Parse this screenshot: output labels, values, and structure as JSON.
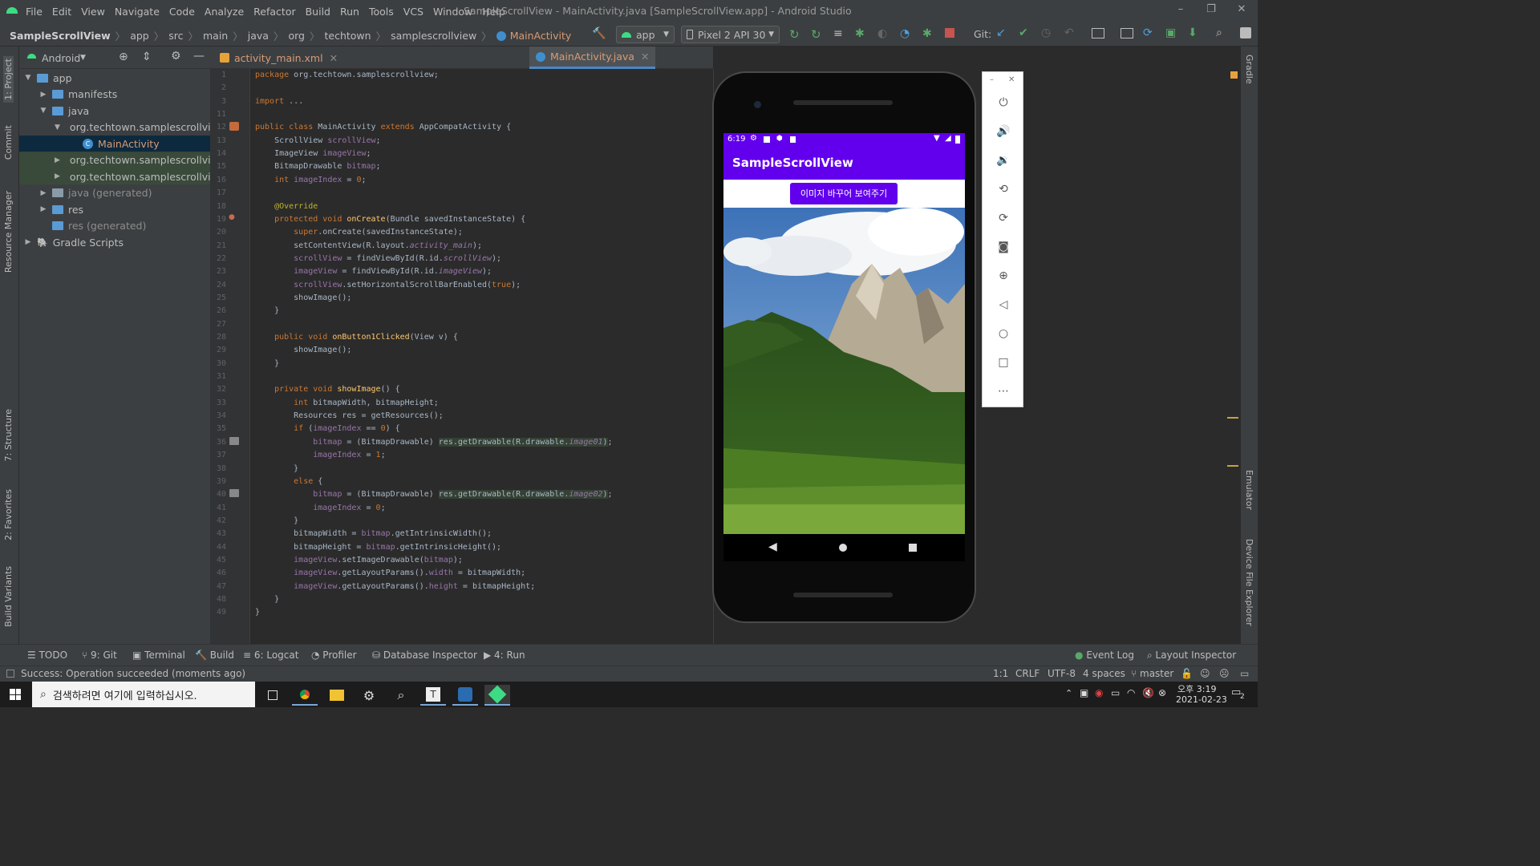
{
  "titlebar": {
    "menu": [
      "File",
      "Edit",
      "View",
      "Navigate",
      "Code",
      "Analyze",
      "Refactor",
      "Build",
      "Run",
      "Tools",
      "VCS",
      "Window",
      "Help"
    ],
    "title": "SampleScrollView - MainActivity.java [SampleScrollView.app] - Android Studio"
  },
  "navbar": {
    "breadcrumb": [
      "SampleScrollView",
      "app",
      "src",
      "main",
      "java",
      "org",
      "techtown",
      "samplescrollview",
      "MainActivity"
    ],
    "run_config": "app",
    "device": "Pixel 2 API 30",
    "git_label": "Git:"
  },
  "left_tool_tabs": [
    "1: Project",
    "Commit",
    "Resource Manager",
    "7: Structure",
    "2: Favorites",
    "Build Variants"
  ],
  "right_tool_tabs": [
    "Gradle",
    "Emulator",
    "Device File Explorer"
  ],
  "project_panel": {
    "view_mode": "Android",
    "tree": [
      {
        "label": "app",
        "indent": 0,
        "arrow": "▼",
        "icon": "folder"
      },
      {
        "label": "manifests",
        "indent": 1,
        "arrow": "▶",
        "icon": "folder"
      },
      {
        "label": "java",
        "indent": 1,
        "arrow": "▼",
        "icon": "folder"
      },
      {
        "label": "org.techtown.samplescrollview",
        "indent": 2,
        "arrow": "▼",
        "icon": "package"
      },
      {
        "label": "MainActivity",
        "indent": 3,
        "arrow": "",
        "icon": "class",
        "selected": true
      },
      {
        "label": "org.techtown.samplescrollview",
        "indent": 2,
        "arrow": "▶",
        "icon": "package",
        "highlight": true
      },
      {
        "label": "org.techtown.samplescrollview",
        "indent": 2,
        "arrow": "▶",
        "icon": "package",
        "highlight": true
      },
      {
        "label": "java (generated)",
        "indent": 1,
        "arrow": "▶",
        "icon": "folder-grey"
      },
      {
        "label": "res",
        "indent": 1,
        "arrow": "▶",
        "icon": "folder"
      },
      {
        "label": "res (generated)",
        "indent": 1,
        "arrow": "",
        "icon": "folder"
      },
      {
        "label": "Gradle Scripts",
        "indent": 0,
        "arrow": "▶",
        "icon": "gradle"
      }
    ]
  },
  "editor": {
    "tabs": [
      {
        "label": "activity_main.xml",
        "active": false
      },
      {
        "label": "MainActivity.java",
        "active": true
      }
    ],
    "line_numbers": [
      "1",
      "2",
      "3",
      "11",
      "12",
      "13",
      "14",
      "15",
      "16",
      "17",
      "18",
      "19",
      "20",
      "21",
      "22",
      "23",
      "24",
      "25",
      "26",
      "27",
      "28",
      "29",
      "30",
      "31",
      "32",
      "33",
      "34",
      "35",
      "36",
      "37",
      "38",
      "39",
      "40",
      "41",
      "42",
      "43",
      "44",
      "45",
      "46",
      "47",
      "48",
      "49"
    ],
    "lines": [
      [
        [
          "kw",
          "package "
        ],
        [
          "",
          "org.techtown.samplescrollview;"
        ]
      ],
      [],
      [
        [
          "kw",
          "import "
        ],
        [
          "",
          "..."
        ]
      ],
      [],
      [
        [
          "kw",
          "public class "
        ],
        [
          "",
          "MainActivity "
        ],
        [
          "kw",
          "extends "
        ],
        [
          "",
          "AppCompatActivity {"
        ]
      ],
      [
        [
          "",
          "    ScrollView "
        ],
        [
          "fld",
          "scrollView"
        ],
        [
          "",
          ";"
        ]
      ],
      [
        [
          "",
          "    ImageView "
        ],
        [
          "fld",
          "imageView"
        ],
        [
          "",
          ";"
        ]
      ],
      [
        [
          "",
          "    BitmapDrawable "
        ],
        [
          "fld",
          "bitmap"
        ],
        [
          "",
          ";"
        ]
      ],
      [
        [
          "kw",
          "    int "
        ],
        [
          "fld",
          "imageIndex "
        ],
        [
          "",
          "= "
        ],
        [
          "kw",
          "0"
        ],
        [
          "",
          ";"
        ]
      ],
      [],
      [
        [
          "ann",
          "    @Override"
        ]
      ],
      [
        [
          "kw",
          "    protected void "
        ],
        [
          "fn",
          "onCreate"
        ],
        [
          "",
          "(Bundle savedInstanceState) {"
        ]
      ],
      [
        [
          "kw",
          "        super"
        ],
        [
          "",
          ".onCreate(savedInstanceState);"
        ]
      ],
      [
        [
          "",
          "        setContentView(R.layout."
        ],
        [
          "fld it",
          "activity_main"
        ],
        [
          "",
          ");"
        ]
      ],
      [
        [
          "fld",
          "        scrollView "
        ],
        [
          "",
          "= findViewById(R.id."
        ],
        [
          "fld it",
          "scrollView"
        ],
        [
          "",
          ");"
        ]
      ],
      [
        [
          "fld",
          "        imageView "
        ],
        [
          "",
          "= findViewById(R.id."
        ],
        [
          "fld it",
          "imageView"
        ],
        [
          "",
          ");"
        ]
      ],
      [
        [
          "fld",
          "        scrollView"
        ],
        [
          "",
          ".setHorizontalScrollBarEnabled("
        ],
        [
          "kw",
          "true"
        ],
        [
          "",
          ");"
        ]
      ],
      [
        [
          "",
          "        showImage();"
        ]
      ],
      [
        [
          "",
          "    }"
        ]
      ],
      [],
      [
        [
          "kw",
          "    public void "
        ],
        [
          "fn",
          "onButton1Clicked"
        ],
        [
          "",
          "(View v) {"
        ]
      ],
      [
        [
          "",
          "        showImage();"
        ]
      ],
      [
        [
          "",
          "    }"
        ]
      ],
      [],
      [
        [
          "kw",
          "    private void "
        ],
        [
          "fn",
          "showImage"
        ],
        [
          "",
          "() {"
        ]
      ],
      [
        [
          "kw",
          "        int "
        ],
        [
          "",
          "bitmapWidth, bitmapHeight;"
        ]
      ],
      [
        [
          "",
          "        Resources res = getResources();"
        ]
      ],
      [
        [
          "kw",
          "        if "
        ],
        [
          "",
          "("
        ],
        [
          "fld",
          "imageIndex "
        ],
        [
          "",
          "== "
        ],
        [
          "kw",
          "0"
        ],
        [
          "",
          ") {"
        ]
      ],
      [
        [
          "fld",
          "            bitmap "
        ],
        [
          "",
          "= (BitmapDrawable) "
        ],
        [
          "hi",
          "res.getDrawable(R.drawable."
        ],
        [
          "hi fld it",
          "image01"
        ],
        [
          "hi",
          ")"
        ],
        [
          "",
          ";"
        ]
      ],
      [
        [
          "fld",
          "            imageIndex "
        ],
        [
          "",
          "= "
        ],
        [
          "kw",
          "1"
        ],
        [
          "",
          ";"
        ]
      ],
      [
        [
          "",
          "        }"
        ]
      ],
      [
        [
          "kw",
          "        else "
        ],
        [
          "",
          "{"
        ]
      ],
      [
        [
          "fld",
          "            bitmap "
        ],
        [
          "",
          "= (BitmapDrawable) "
        ],
        [
          "hi",
          "res.getDrawable(R.drawable."
        ],
        [
          "hi fld it",
          "image02"
        ],
        [
          "hi",
          ")"
        ],
        [
          "",
          ";"
        ]
      ],
      [
        [
          "fld",
          "            imageIndex "
        ],
        [
          "",
          "= "
        ],
        [
          "kw",
          "0"
        ],
        [
          "",
          ";"
        ]
      ],
      [
        [
          "",
          "        }"
        ]
      ],
      [
        [
          "",
          "        bitmapWidth = "
        ],
        [
          "fld",
          "bitmap"
        ],
        [
          "",
          ".getIntrinsicWidth();"
        ]
      ],
      [
        [
          "",
          "        bitmapHeight = "
        ],
        [
          "fld",
          "bitmap"
        ],
        [
          "",
          ".getIntrinsicHeight();"
        ]
      ],
      [
        [
          "fld",
          "        imageView"
        ],
        [
          "",
          ".setImageDrawable("
        ],
        [
          "fld",
          "bitmap"
        ],
        [
          "",
          ");"
        ]
      ],
      [
        [
          "fld",
          "        imageView"
        ],
        [
          "",
          ".getLayoutParams()."
        ],
        [
          "fld",
          "width "
        ],
        [
          "",
          "= bitmapWidth;"
        ]
      ],
      [
        [
          "fld",
          "        imageView"
        ],
        [
          "",
          ".getLayoutParams()."
        ],
        [
          "fld",
          "height "
        ],
        [
          "",
          "= bitmapHeight;"
        ]
      ],
      [
        [
          "",
          "    }"
        ]
      ],
      [
        [
          "",
          "}"
        ]
      ]
    ]
  },
  "phone": {
    "time": "6:19",
    "app_title": "SampleScrollView",
    "button_label": "이미지 바꾸어 보여주기"
  },
  "emulator_controls": [
    "power-icon",
    "volume-up-icon",
    "volume-down-icon",
    "rotate-left-icon",
    "rotate-right-icon",
    "camera-icon",
    "zoom-icon",
    "back-icon",
    "home-icon",
    "overview-icon",
    "more-icon"
  ],
  "bottom_tabs": [
    "TODO",
    "9: Git",
    "Terminal",
    "Build",
    "6: Logcat",
    "Profiler",
    "Database Inspector",
    "4: Run"
  ],
  "bottom_right_tabs": [
    "Event Log",
    "Layout Inspector"
  ],
  "status": {
    "message": "Success: Operation succeeded (moments ago)",
    "position": "1:1",
    "line_sep": "CRLF",
    "encoding": "UTF-8",
    "indent": "4 spaces",
    "branch": "master"
  },
  "taskbar": {
    "search_placeholder": "검색하려면 여기에 입력하십시오.",
    "time": "오후 3:19",
    "date": "2021-02-23",
    "notification_count": "2"
  },
  "colors": {
    "accent": "#6200ee",
    "selection": "#0d293e",
    "keyword": "#cc7832",
    "field": "#9876aa",
    "function": "#ffc66d"
  }
}
